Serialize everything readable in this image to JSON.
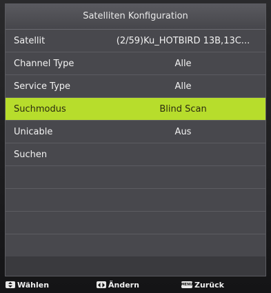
{
  "window": {
    "title": "Satelliten Konfiguration"
  },
  "menu": {
    "rows": [
      {
        "label": "Satellit",
        "value": "(2/59)Ku_HOTBIRD 13B,13C..."
      },
      {
        "label": "Channel Type",
        "value": "Alle"
      },
      {
        "label": "Service Type",
        "value": "Alle"
      },
      {
        "label": "Suchmodus",
        "value": "Blind Scan"
      },
      {
        "label": "Unicable",
        "value": "Aus"
      },
      {
        "label": "Suchen",
        "value": ""
      }
    ],
    "selected_index": 3
  },
  "help": {
    "select_label": "Wählen",
    "change_label": "Ändern",
    "back_label": "Zurück",
    "menu_key_text": "MENU"
  },
  "colors": {
    "highlight": "#b7dd2c",
    "panel": "#48484d"
  }
}
